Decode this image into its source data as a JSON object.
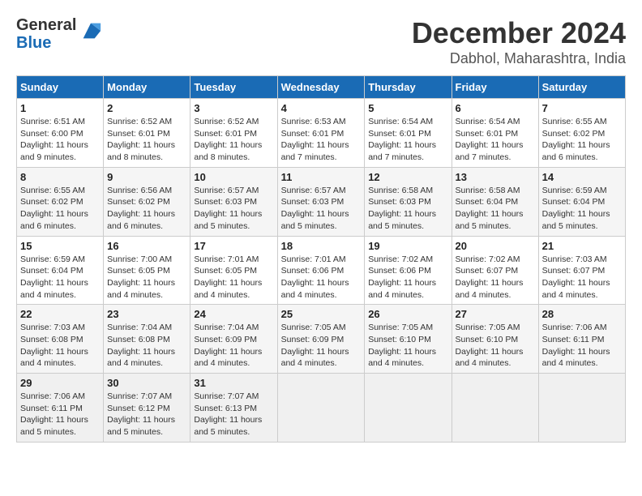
{
  "logo": {
    "general": "General",
    "blue": "Blue"
  },
  "title": "December 2024",
  "location": "Dabhol, Maharashtra, India",
  "weekdays": [
    "Sunday",
    "Monday",
    "Tuesday",
    "Wednesday",
    "Thursday",
    "Friday",
    "Saturday"
  ],
  "weeks": [
    [
      {
        "day": "1",
        "sunrise": "6:51 AM",
        "sunset": "6:00 PM",
        "daylight": "11 hours and 9 minutes."
      },
      {
        "day": "2",
        "sunrise": "6:52 AM",
        "sunset": "6:01 PM",
        "daylight": "11 hours and 8 minutes."
      },
      {
        "day": "3",
        "sunrise": "6:52 AM",
        "sunset": "6:01 PM",
        "daylight": "11 hours and 8 minutes."
      },
      {
        "day": "4",
        "sunrise": "6:53 AM",
        "sunset": "6:01 PM",
        "daylight": "11 hours and 7 minutes."
      },
      {
        "day": "5",
        "sunrise": "6:54 AM",
        "sunset": "6:01 PM",
        "daylight": "11 hours and 7 minutes."
      },
      {
        "day": "6",
        "sunrise": "6:54 AM",
        "sunset": "6:01 PM",
        "daylight": "11 hours and 7 minutes."
      },
      {
        "day": "7",
        "sunrise": "6:55 AM",
        "sunset": "6:02 PM",
        "daylight": "11 hours and 6 minutes."
      }
    ],
    [
      {
        "day": "8",
        "sunrise": "6:55 AM",
        "sunset": "6:02 PM",
        "daylight": "11 hours and 6 minutes."
      },
      {
        "day": "9",
        "sunrise": "6:56 AM",
        "sunset": "6:02 PM",
        "daylight": "11 hours and 6 minutes."
      },
      {
        "day": "10",
        "sunrise": "6:57 AM",
        "sunset": "6:03 PM",
        "daylight": "11 hours and 5 minutes."
      },
      {
        "day": "11",
        "sunrise": "6:57 AM",
        "sunset": "6:03 PM",
        "daylight": "11 hours and 5 minutes."
      },
      {
        "day": "12",
        "sunrise": "6:58 AM",
        "sunset": "6:03 PM",
        "daylight": "11 hours and 5 minutes."
      },
      {
        "day": "13",
        "sunrise": "6:58 AM",
        "sunset": "6:04 PM",
        "daylight": "11 hours and 5 minutes."
      },
      {
        "day": "14",
        "sunrise": "6:59 AM",
        "sunset": "6:04 PM",
        "daylight": "11 hours and 5 minutes."
      }
    ],
    [
      {
        "day": "15",
        "sunrise": "6:59 AM",
        "sunset": "6:04 PM",
        "daylight": "11 hours and 4 minutes."
      },
      {
        "day": "16",
        "sunrise": "7:00 AM",
        "sunset": "6:05 PM",
        "daylight": "11 hours and 4 minutes."
      },
      {
        "day": "17",
        "sunrise": "7:01 AM",
        "sunset": "6:05 PM",
        "daylight": "11 hours and 4 minutes."
      },
      {
        "day": "18",
        "sunrise": "7:01 AM",
        "sunset": "6:06 PM",
        "daylight": "11 hours and 4 minutes."
      },
      {
        "day": "19",
        "sunrise": "7:02 AM",
        "sunset": "6:06 PM",
        "daylight": "11 hours and 4 minutes."
      },
      {
        "day": "20",
        "sunrise": "7:02 AM",
        "sunset": "6:07 PM",
        "daylight": "11 hours and 4 minutes."
      },
      {
        "day": "21",
        "sunrise": "7:03 AM",
        "sunset": "6:07 PM",
        "daylight": "11 hours and 4 minutes."
      }
    ],
    [
      {
        "day": "22",
        "sunrise": "7:03 AM",
        "sunset": "6:08 PM",
        "daylight": "11 hours and 4 minutes."
      },
      {
        "day": "23",
        "sunrise": "7:04 AM",
        "sunset": "6:08 PM",
        "daylight": "11 hours and 4 minutes."
      },
      {
        "day": "24",
        "sunrise": "7:04 AM",
        "sunset": "6:09 PM",
        "daylight": "11 hours and 4 minutes."
      },
      {
        "day": "25",
        "sunrise": "7:05 AM",
        "sunset": "6:09 PM",
        "daylight": "11 hours and 4 minutes."
      },
      {
        "day": "26",
        "sunrise": "7:05 AM",
        "sunset": "6:10 PM",
        "daylight": "11 hours and 4 minutes."
      },
      {
        "day": "27",
        "sunrise": "7:05 AM",
        "sunset": "6:10 PM",
        "daylight": "11 hours and 4 minutes."
      },
      {
        "day": "28",
        "sunrise": "7:06 AM",
        "sunset": "6:11 PM",
        "daylight": "11 hours and 4 minutes."
      }
    ],
    [
      {
        "day": "29",
        "sunrise": "7:06 AM",
        "sunset": "6:11 PM",
        "daylight": "11 hours and 5 minutes."
      },
      {
        "day": "30",
        "sunrise": "7:07 AM",
        "sunset": "6:12 PM",
        "daylight": "11 hours and 5 minutes."
      },
      {
        "day": "31",
        "sunrise": "7:07 AM",
        "sunset": "6:13 PM",
        "daylight": "11 hours and 5 minutes."
      },
      null,
      null,
      null,
      null
    ]
  ],
  "labels": {
    "sunrise": "Sunrise:",
    "sunset": "Sunset:",
    "daylight": "Daylight:"
  }
}
